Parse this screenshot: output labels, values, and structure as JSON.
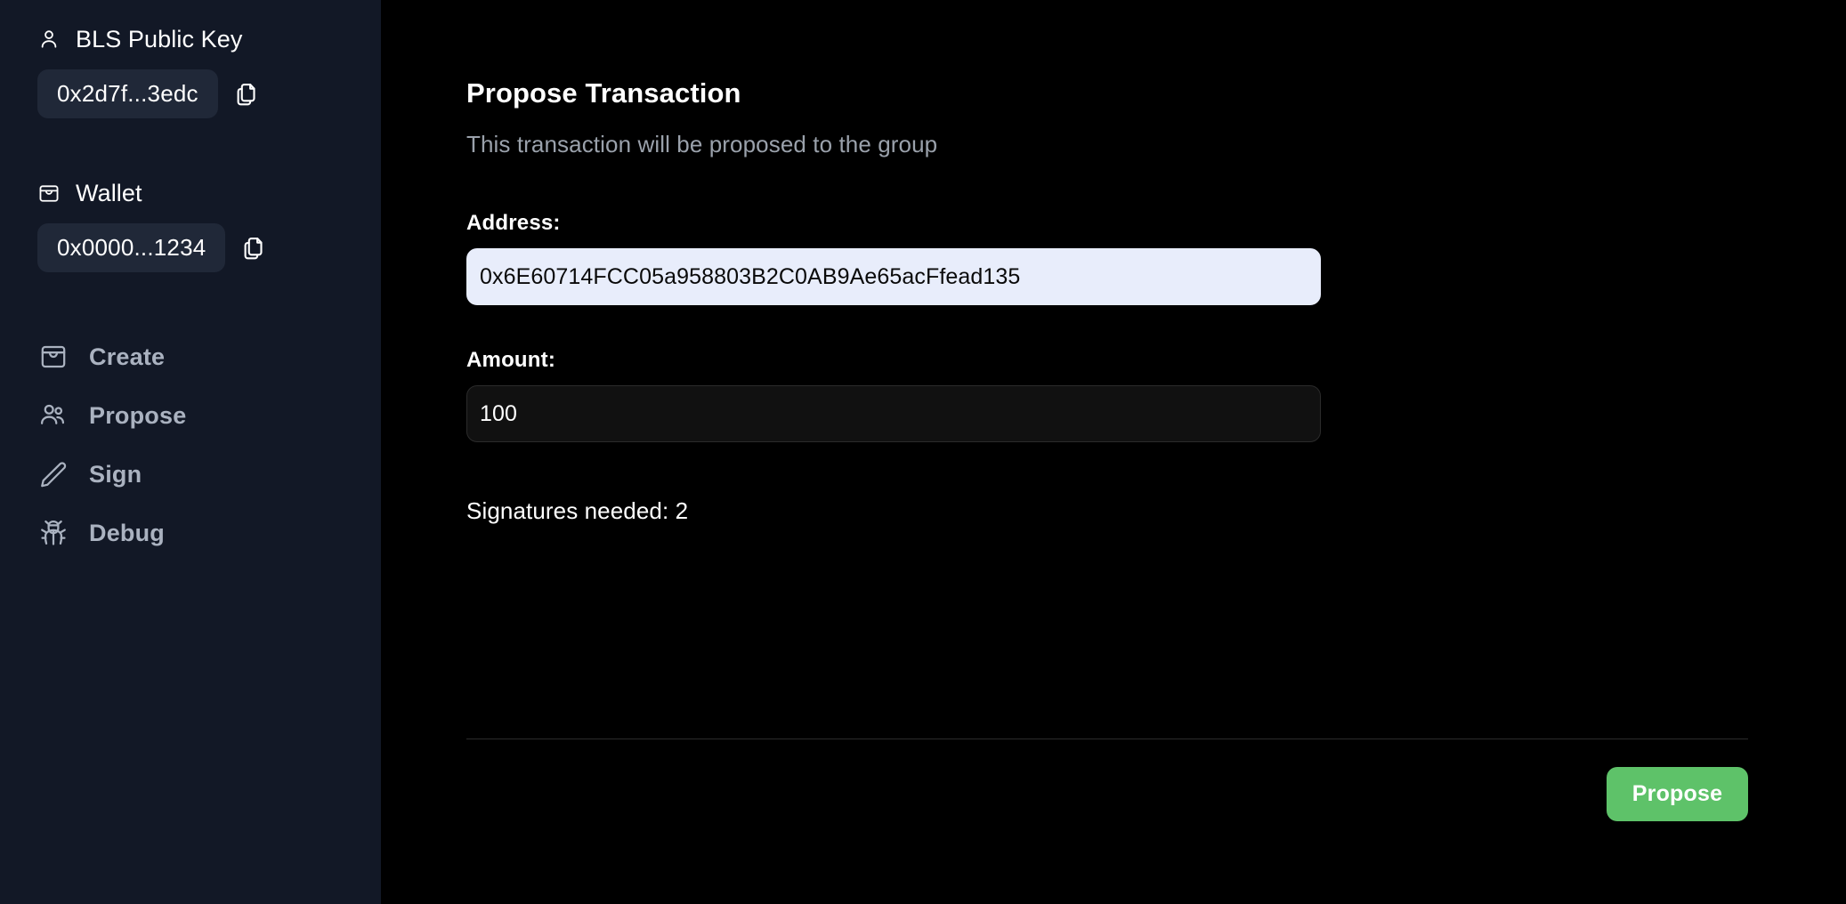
{
  "sidebar": {
    "blsKey": {
      "icon": "user-icon",
      "title": "BLS Public Key",
      "value": "0x2d7f...3edc",
      "copy_icon": "copy-icon"
    },
    "wallet": {
      "icon": "wallet-icon",
      "title": "Wallet",
      "value": "0x0000...1234",
      "copy_icon": "copy-icon"
    },
    "nav": [
      {
        "id": "create",
        "label": "Create",
        "icon": "archive-icon"
      },
      {
        "id": "propose",
        "label": "Propose",
        "icon": "users-icon"
      },
      {
        "id": "sign",
        "label": "Sign",
        "icon": "pencil-icon"
      },
      {
        "id": "debug",
        "label": "Debug",
        "icon": "bug-icon"
      }
    ]
  },
  "main": {
    "title": "Propose Transaction",
    "subtitle": "This transaction will be proposed to the group",
    "fields": {
      "address": {
        "label": "Address:",
        "value": "0x6E60714FCC05a958803B2C0AB9Ae65acFfead135",
        "placeholder": "Address"
      },
      "amount": {
        "label": "Amount:",
        "value": "100",
        "placeholder": "Amount"
      }
    },
    "signatures_needed": "Signatures needed: 2",
    "submit_label": "Propose"
  },
  "colors": {
    "sidebar_bg": "#121826",
    "main_bg": "#000000",
    "chip_bg": "#202838",
    "accent_green": "#5ec269",
    "autofill_bg": "#e8edfb",
    "muted_text": "#9aa1ab",
    "nav_text": "#aab2c0"
  }
}
